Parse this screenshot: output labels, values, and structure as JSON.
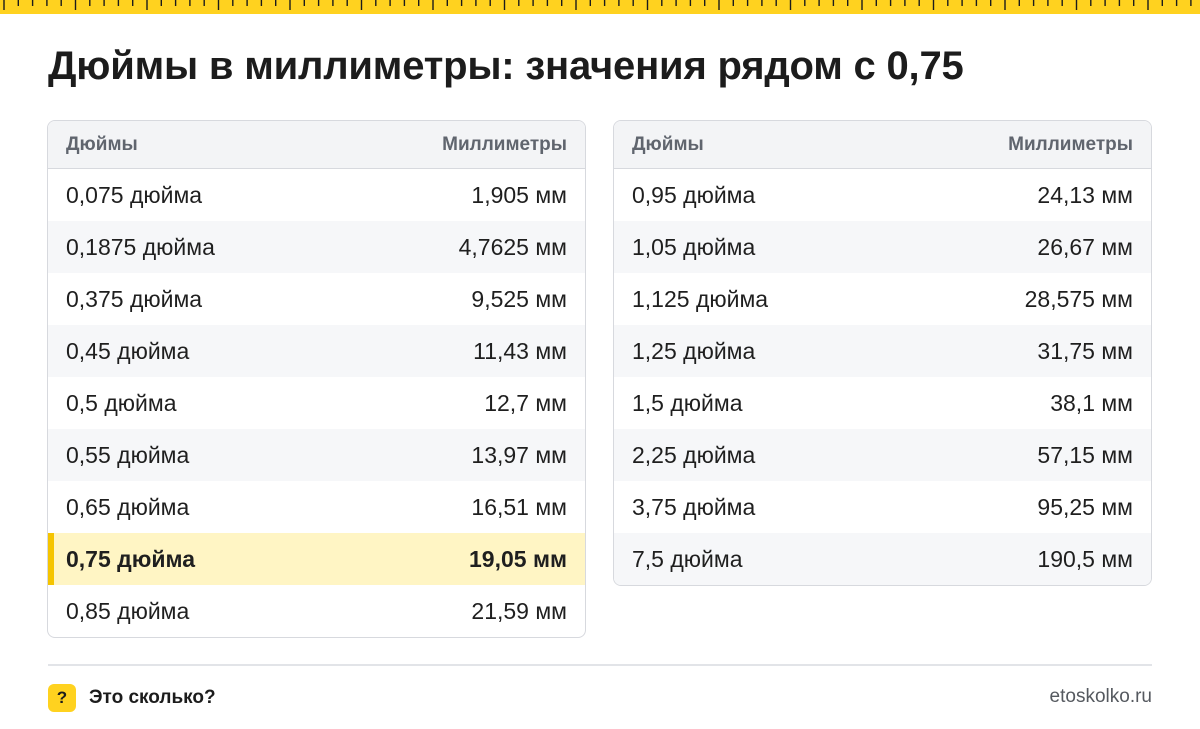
{
  "title": "Дюймы в миллиметры: значения рядом с 0,75",
  "colors": {
    "accent": "#ffd21f",
    "highlight_bg": "#fff5c4",
    "highlight_bar": "#f5c400",
    "header_bg": "#f3f4f6",
    "border": "#d7d9de"
  },
  "tables": [
    {
      "headers": {
        "inches": "Дюймы",
        "mm": "Миллиметры"
      },
      "rows": [
        {
          "inches": "0,075 дюйма",
          "mm": "1,905 мм"
        },
        {
          "inches": "0,1875 дюйма",
          "mm": "4,7625 мм"
        },
        {
          "inches": "0,375 дюйма",
          "mm": "9,525 мм"
        },
        {
          "inches": "0,45 дюйма",
          "mm": "11,43 мм"
        },
        {
          "inches": "0,5 дюйма",
          "mm": "12,7 мм"
        },
        {
          "inches": "0,55 дюйма",
          "mm": "13,97 мм"
        },
        {
          "inches": "0,65 дюйма",
          "mm": "16,51 мм"
        },
        {
          "inches": "0,75 дюйма",
          "mm": "19,05 мм",
          "highlighted": true
        },
        {
          "inches": "0,85 дюйма",
          "mm": "21,59 мм"
        }
      ]
    },
    {
      "headers": {
        "inches": "Дюймы",
        "mm": "Миллиметры"
      },
      "rows": [
        {
          "inches": "0,95 дюйма",
          "mm": "24,13 мм"
        },
        {
          "inches": "1,05 дюйма",
          "mm": "26,67 мм"
        },
        {
          "inches": "1,125 дюйма",
          "mm": "28,575 мм"
        },
        {
          "inches": "1,25 дюйма",
          "mm": "31,75 мм"
        },
        {
          "inches": "1,5 дюйма",
          "mm": "38,1 мм"
        },
        {
          "inches": "2,25 дюйма",
          "mm": "57,15 мм"
        },
        {
          "inches": "3,75 дюйма",
          "mm": "95,25 мм"
        },
        {
          "inches": "7,5 дюйма",
          "mm": "190,5 мм"
        }
      ]
    }
  ],
  "footer": {
    "brand_icon": "question-mark-icon",
    "brand_icon_glyph": "?",
    "brand_name": "Это сколько?",
    "site": "etoskolko.ru"
  }
}
